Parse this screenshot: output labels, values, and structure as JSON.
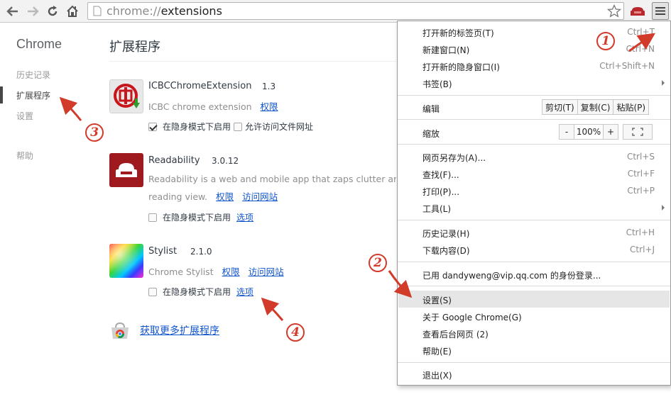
{
  "toolbar": {
    "url_scheme": "chrome://",
    "url_host": "extensions",
    "colors": {
      "ext_icon": "#b8282c"
    }
  },
  "sidebar": {
    "title": "Chrome",
    "items": [
      {
        "label": "历史记录",
        "active": false
      },
      {
        "label": "扩展程序",
        "active": true
      },
      {
        "label": "设置",
        "active": false
      },
      {
        "label": "帮助",
        "active": false
      }
    ]
  },
  "main": {
    "title": "扩展程序",
    "extensions": [
      {
        "name": "ICBCChromeExtension",
        "version": "1.3",
        "desc": "ICBC chrome extension",
        "links": [
          "权限"
        ],
        "incognito_label": "在隐身模式下启用",
        "incognito_checked": true,
        "file_access_label": "允许访问文件网址",
        "file_access_checked": false
      },
      {
        "name": "Readability",
        "version": "3.0.12",
        "desc_line1": "Readability is a web and mobile app that zaps clutter and sa",
        "desc_line2": "reading view.",
        "links": [
          "权限",
          "访问网站"
        ],
        "incognito_label": "在隐身模式下启用",
        "incognito_checked": false,
        "options_label": "选项"
      },
      {
        "name": "Stylist",
        "version": "2.1.0",
        "desc": "Chrome Stylist",
        "links": [
          "权限",
          "访问网站"
        ],
        "incognito_label": "在隐身模式下启用",
        "incognito_checked": false,
        "options_label": "选项"
      }
    ],
    "more_link": "获取更多扩展程序"
  },
  "menu": {
    "items": [
      {
        "label": "打开新的标签页(T)",
        "shortcut": "Ctrl+T"
      },
      {
        "label": "新建窗口(N)",
        "shortcut": "Ctrl+N"
      },
      {
        "label": "打开新的隐身窗口(I)",
        "shortcut": "Ctrl+Shift+N"
      },
      {
        "label": "书签(B)",
        "shortcut": ""
      },
      {
        "label": "编辑",
        "buttons": [
          "剪切(T)",
          "复制(C)",
          "粘贴(P)"
        ]
      },
      {
        "label": "缩放",
        "zoom": {
          "minus": "-",
          "value": "100%",
          "plus": "+"
        }
      },
      {
        "label": "网页另存为(A)...",
        "shortcut": "Ctrl+S"
      },
      {
        "label": "查找(F)...",
        "shortcut": "Ctrl+F"
      },
      {
        "label": "打印(P)...",
        "shortcut": "Ctrl+P"
      },
      {
        "label": "工具(L)",
        "shortcut": ""
      },
      {
        "label": "历史记录(H)",
        "shortcut": "Ctrl+H"
      },
      {
        "label": "下载内容(D)",
        "shortcut": "Ctrl+J"
      },
      {
        "label": "已用 dandyweng@vip.qq.com 的身份登录...",
        "shortcut": ""
      },
      {
        "label": "设置(S)",
        "shortcut": "",
        "highlighted": true
      },
      {
        "label": "关于 Google Chrome(G)",
        "shortcut": ""
      },
      {
        "label": "查看后台网页 (2)",
        "shortcut": ""
      },
      {
        "label": "帮助(E)",
        "shortcut": ""
      },
      {
        "label": "退出(X)",
        "shortcut": ""
      }
    ]
  },
  "annotations": {
    "n1": "1",
    "n2": "2",
    "n3": "3",
    "n4": "4",
    "color": "#d23a2a"
  }
}
